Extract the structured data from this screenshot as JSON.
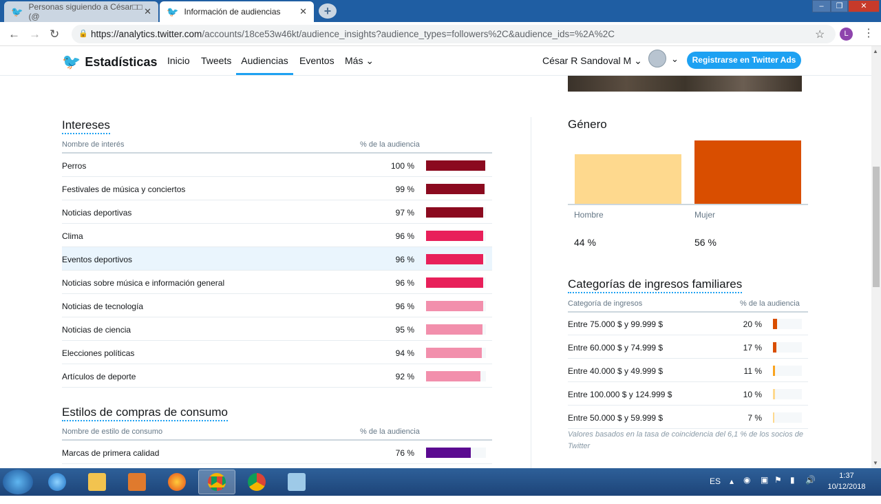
{
  "browser": {
    "tabs": [
      {
        "label": "Personas siguiendo a César□□ (@",
        "active": false
      },
      {
        "label": "Información de audiencias",
        "active": true
      }
    ],
    "url_host": "https://analytics.twitter.com",
    "url_path": "/accounts/18ce53w46kt/audience_insights?audience_types=followers%2C&audience_ids=%2A%2C",
    "profile_initial": "L"
  },
  "header": {
    "brand": "Estadísticas",
    "nav": [
      "Inicio",
      "Tweets",
      "Audiencias",
      "Eventos",
      "Más"
    ],
    "active_nav": "Audiencias",
    "user": "César R Sandoval M",
    "ads_button": "Registrarse en Twitter Ads"
  },
  "interests": {
    "title": "Intereses",
    "col_name": "Nombre de interés",
    "col_pct": "% de la audiencia",
    "rows": [
      {
        "name": "Perros",
        "pct_label": "100 %",
        "value": 100,
        "color": "#8b0a1f"
      },
      {
        "name": "Festivales de música y conciertos",
        "pct_label": "99 %",
        "value": 99,
        "color": "#8b0a1f"
      },
      {
        "name": "Noticias deportivas",
        "pct_label": "97 %",
        "value": 97,
        "color": "#8b0a1f"
      },
      {
        "name": "Clima",
        "pct_label": "96 %",
        "value": 96,
        "color": "#e8205a"
      },
      {
        "name": "Eventos deportivos",
        "pct_label": "96 %",
        "value": 96,
        "color": "#e8205a"
      },
      {
        "name": "Noticias sobre música e información general",
        "pct_label": "96 %",
        "value": 96,
        "color": "#e8205a"
      },
      {
        "name": "Noticias de tecnología",
        "pct_label": "96 %",
        "value": 96,
        "color": "#f28fac"
      },
      {
        "name": "Noticias de ciencia",
        "pct_label": "95 %",
        "value": 95,
        "color": "#f28fac"
      },
      {
        "name": "Elecciones políticas",
        "pct_label": "94 %",
        "value": 94,
        "color": "#f28fac"
      },
      {
        "name": "Artículos de deporte",
        "pct_label": "92 %",
        "value": 92,
        "color": "#f28fac"
      }
    ]
  },
  "consumer": {
    "title": "Estilos de compras de consumo",
    "col_name": "Nombre de estilo de consumo",
    "col_pct": "% de la audiencia",
    "rows": [
      {
        "name": "Marcas de primera calidad",
        "pct_label": "76 %",
        "value": 76,
        "color": "#5b0a91"
      }
    ]
  },
  "gender": {
    "title": "Género",
    "bars": [
      {
        "label": "Hombre",
        "pct_label": "44 %",
        "value": 44,
        "color": "#fed98e"
      },
      {
        "label": "Mujer",
        "pct_label": "56 %",
        "value": 56,
        "color": "#d94e00"
      }
    ]
  },
  "income": {
    "title": "Categorías de ingresos familiares",
    "col_name": "Categoría de ingresos",
    "col_pct": "% de la audiencia",
    "rows": [
      {
        "name": "Entre 75.000 $ y 99.999 $",
        "pct_label": "20 %",
        "value": 20,
        "color": "#d94e00"
      },
      {
        "name": "Entre 60.000 $ y 74.999 $",
        "pct_label": "17 %",
        "value": 17,
        "color": "#d94e00"
      },
      {
        "name": "Entre 40.000 $ y 49.999 $",
        "pct_label": "11 %",
        "value": 11,
        "color": "#f9a41f"
      },
      {
        "name": "Entre 100.000 $ y 124.999 $",
        "pct_label": "10 %",
        "value": 10,
        "color": "#fed98e"
      },
      {
        "name": "Entre 50.000 $ y 59.999 $",
        "pct_label": "7 %",
        "value": 7,
        "color": "#fed98e"
      }
    ],
    "note": "Valores basados en la tasa de coincidencia del 6,1 % de los socios de Twitter"
  },
  "taskbar": {
    "lang": "ES",
    "time": "1:37",
    "date": "10/12/2018"
  }
}
